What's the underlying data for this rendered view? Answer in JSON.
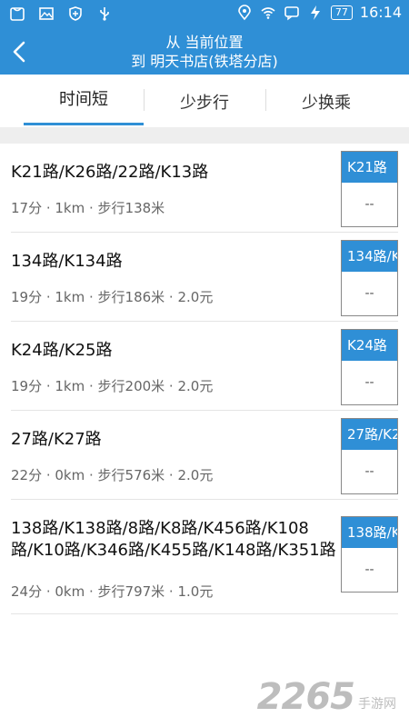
{
  "status_bar": {
    "battery": "77",
    "time": "16:14"
  },
  "header": {
    "line1": "从 当前位置",
    "line2": "到 明天书店(铁塔分店)"
  },
  "tabs": [
    {
      "label": "时间短"
    },
    {
      "label": "少步行"
    },
    {
      "label": "少换乘"
    }
  ],
  "routes": [
    {
      "title": "K21路/K26路/22路/K13路",
      "meta": "17分 · 1km · 步行138米",
      "badge": "K21路",
      "badge_value": "--"
    },
    {
      "title": "134路/K134路",
      "meta": "19分 · 1km · 步行186米 · 2.0元",
      "badge": "134路/K",
      "badge_value": "--"
    },
    {
      "title": "K24路/K25路",
      "meta": "19分 · 1km · 步行200米 · 2.0元",
      "badge": "K24路",
      "badge_value": "--"
    },
    {
      "title": "27路/K27路",
      "meta": "22分 · 0km · 步行576米 · 2.0元",
      "badge": "27路/K2",
      "badge_value": "--"
    },
    {
      "title": "138路/K138路/8路/K8路/K456路/K108路/K10路/K346路/K455路/K148路/K351路",
      "meta": "24分 · 0km · 步行797米 · 1.0元",
      "badge": "138路/K",
      "badge_value": "--"
    }
  ],
  "watermark": {
    "number": "2265",
    "text": "手游网"
  }
}
